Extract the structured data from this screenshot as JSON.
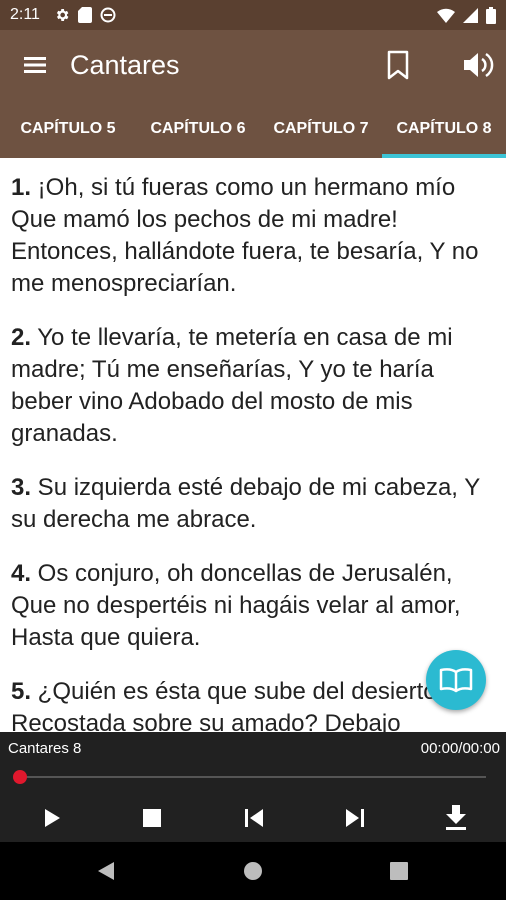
{
  "status_bar": {
    "time": "2:11",
    "left_icons": [
      "gear-icon",
      "sd-card-icon",
      "no-disturb-icon"
    ],
    "right_icons": [
      "wifi-icon",
      "signal-icon",
      "battery-icon"
    ]
  },
  "app_bar": {
    "title": "Cantares",
    "actions": [
      "menu-icon",
      "bookmark-icon",
      "speaker-icon"
    ]
  },
  "tabs": {
    "items": [
      "CAPÍTULO 5",
      "CAPÍTULO 6",
      "CAPÍTULO 7",
      "CAPÍTULO 8"
    ],
    "selected": "CAPÍTULO 8",
    "indicator_color": "#3cc4d6"
  },
  "verses": [
    {
      "num": "1.",
      "text": " ¡Oh, si tú fueras como un hermano mío Que mamó los pechos de mi madre! Entonces, hallándote fuera, te besaría, Y no me menospreciarían."
    },
    {
      "num": "2.",
      "text": " Yo te llevaría, te metería en casa de mi madre; Tú me enseñarías, Y yo te haría beber vino Adobado del mosto de mis granadas."
    },
    {
      "num": "3.",
      "text": " Su izquierda esté debajo de mi cabeza, Y su derecha me abrace."
    },
    {
      "num": "4.",
      "text": " Os conjuro, oh doncellas de Jerusalén, Que no despertéis ni hagáis velar al amor, Hasta que quiera."
    },
    {
      "num": "5.",
      "text": " ¿Quién es ésta que sube del desierto, Recostada sobre su amado? Debajo"
    }
  ],
  "fab": {
    "icon": "book-open-icon",
    "color": "#2bbad1"
  },
  "player": {
    "track_title": "Cantares 8",
    "time_display": "00:00/00:00",
    "progress": 0,
    "controls": [
      "play-icon",
      "stop-icon",
      "skip-previous-icon",
      "skip-next-icon",
      "download-icon"
    ],
    "thumb_color": "#e0182d"
  },
  "nav_bar": {
    "buttons": [
      "back-icon",
      "home-icon",
      "recents-icon"
    ]
  },
  "colors": {
    "toolbar": "#6e5241",
    "status_bar": "#5a4030",
    "player": "#212121"
  }
}
